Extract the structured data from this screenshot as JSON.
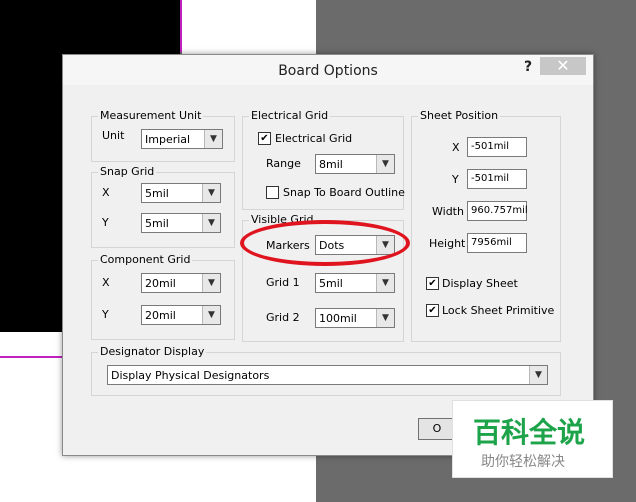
{
  "dialog": {
    "title": "Board Options",
    "help_label": "?",
    "close_label": "✕"
  },
  "measurement_unit": {
    "title": "Measurement Unit",
    "unit_label": "Unit",
    "unit_value": "Imperial"
  },
  "snap_grid": {
    "title": "Snap Grid",
    "x_label": "X",
    "x_value": "5mil",
    "y_label": "Y",
    "y_value": "5mil"
  },
  "component_grid": {
    "title": "Component Grid",
    "x_label": "X",
    "x_value": "20mil",
    "y_label": "Y",
    "y_value": "20mil"
  },
  "electrical_grid": {
    "title": "Electrical Grid",
    "checkbox_label": "Electrical Grid",
    "checked": true,
    "range_label": "Range",
    "range_value": "8mil",
    "snap_outline_label": "Snap To Board Outline",
    "snap_outline_checked": false
  },
  "visible_grid": {
    "title": "Visible Grid",
    "markers_label": "Markers",
    "markers_value": "Dots",
    "grid1_label": "Grid 1",
    "grid1_value": "5mil",
    "grid2_label": "Grid 2",
    "grid2_value": "100mil"
  },
  "sheet_position": {
    "title": "Sheet Position",
    "x_label": "X",
    "x_value": "-501mil",
    "y_label": "Y",
    "y_value": "-501mil",
    "width_label": "Width",
    "width_value": "960.757mil",
    "height_label": "Height",
    "height_value": "7956mil",
    "display_sheet_label": "Display Sheet",
    "display_sheet_checked": true,
    "lock_sheet_label": "Lock Sheet Primitive",
    "lock_sheet_checked": true
  },
  "designator_display": {
    "title": "Designator Display",
    "value": "Display Physical Designators"
  },
  "footer": {
    "ok_label": "O"
  },
  "watermark": {
    "title": "百科全说",
    "subtitle": "助你轻松解决"
  }
}
